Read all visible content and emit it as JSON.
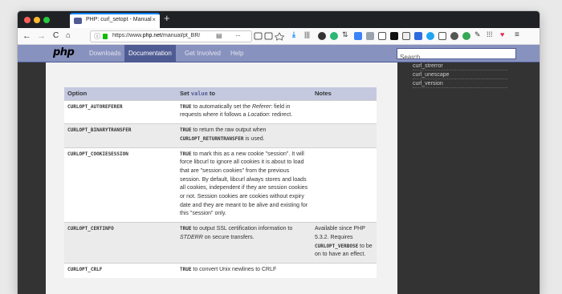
{
  "tab": {
    "title": "PHP: curl_setopt - Manual",
    "close": "×",
    "new": "+"
  },
  "nav": {
    "back": "←",
    "forward": "→",
    "reload": "C",
    "home": "⌂"
  },
  "url": {
    "info": "ⓘ",
    "prefix": "https://www.",
    "host": "php.net",
    "path": "/manual/pt_BR/",
    "reader": "▤",
    "more": "···"
  },
  "php": {
    "logo": "php",
    "links": [
      {
        "label": "Downloads"
      },
      {
        "label": "Documentation"
      },
      {
        "label": "Get Involved"
      },
      {
        "label": "Help"
      }
    ],
    "search_placeholder": "Search"
  },
  "sidebar": {
    "items": [
      "curl_strerror",
      "curl_unescape",
      "curl_version"
    ]
  },
  "table": {
    "headers": {
      "option": "Option",
      "set_prefix": "Set ",
      "set_code": "value",
      "set_suffix": " to",
      "notes": "Notes"
    },
    "rows": [
      {
        "option": "CURLOPT_AUTOREFERER",
        "p1": "TRUE",
        "p2": " to automatically set the ",
        "p3": "Referer",
        "p4": ": field in requests where it follows a ",
        "p5": "Location",
        "p6": ": redirect.",
        "note": ""
      },
      {
        "option": "CURLOPT_BINARYTRANSFER",
        "p1": "TRUE",
        "p2": " to return the raw output when ",
        "p3": "CURLOPT_RETURNTRANSFER",
        "p4": " is used.",
        "note": ""
      },
      {
        "option": "CURLOPT_COOKIESESSION",
        "p1": "TRUE",
        "p2": " to mark this as a new cookie \"session\". It will force libcurl to ignore all cookies it is about to load that are \"session cookies\" from the previous session. By default, libcurl always stores and loads all cookies, independent if they are session cookies or not. Session cookies are cookies without expiry date and they are meant to be alive and existing for this \"session\" only.",
        "note": ""
      },
      {
        "option": "CURLOPT_CERTINFO",
        "p1": "TRUE",
        "p2": " to output SSL certification information to ",
        "p3": "STDERR",
        "p4": " on secure transfers.",
        "note_a": "Available since PHP 5.3.2. Requires ",
        "note_b": "CURLOPT_VERBOSE",
        "note_c": " to be on to have an effect."
      },
      {
        "option": "CURLOPT_CRLF",
        "p1": "TRUE",
        "p2": " to convert Unix newlines to CRLF"
      }
    ]
  }
}
